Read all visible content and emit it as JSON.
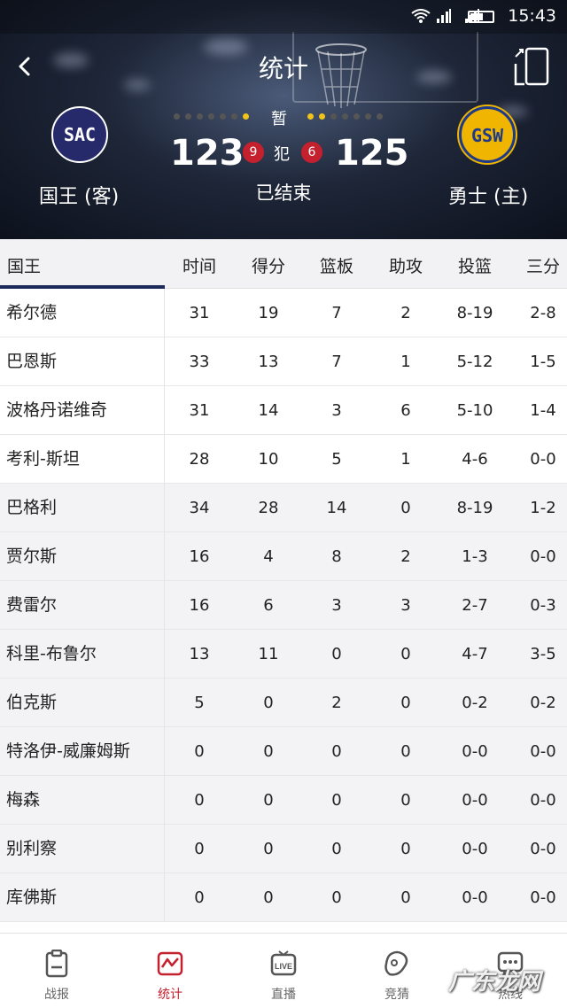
{
  "status_bar": {
    "time": "15:43"
  },
  "header": {
    "title": "统计",
    "away": {
      "abbr": "SAC",
      "name": "国王 (客)",
      "score": "123",
      "fouls": "9",
      "logo_color": "#272a6a"
    },
    "home": {
      "abbr": "GSW",
      "name": "勇士 (主)",
      "score": "125",
      "fouls": "6",
      "logo_color": "#f0b500"
    },
    "timeout_label": "暂",
    "foul_label": "犯",
    "game_status": "已结束",
    "timeouts": {
      "away": [
        "#555",
        "#555",
        "#555",
        "#555",
        "#555",
        "#555",
        "#f0c419"
      ],
      "home": [
        "#f0c419",
        "#f0c419",
        "#555",
        "#555",
        "#555",
        "#555",
        "#555"
      ]
    }
  },
  "table": {
    "team_tab": "国王",
    "columns": [
      "时间",
      "得分",
      "篮板",
      "助攻",
      "投篮",
      "三分"
    ],
    "rows": [
      {
        "name": "希尔德",
        "min": "31",
        "pts": "19",
        "reb": "7",
        "ast": "2",
        "fg": "8-19",
        "tp": "2-8",
        "starter": true
      },
      {
        "name": "巴恩斯",
        "min": "33",
        "pts": "13",
        "reb": "7",
        "ast": "1",
        "fg": "5-12",
        "tp": "1-5",
        "starter": true
      },
      {
        "name": "波格丹诺维奇",
        "min": "31",
        "pts": "14",
        "reb": "3",
        "ast": "6",
        "fg": "5-10",
        "tp": "1-4",
        "starter": true
      },
      {
        "name": "考利-斯坦",
        "min": "28",
        "pts": "10",
        "reb": "5",
        "ast": "1",
        "fg": "4-6",
        "tp": "0-0",
        "starter": true
      },
      {
        "name": "巴格利",
        "min": "34",
        "pts": "28",
        "reb": "14",
        "ast": "0",
        "fg": "8-19",
        "tp": "1-2",
        "starter": false
      },
      {
        "name": "贾尔斯",
        "min": "16",
        "pts": "4",
        "reb": "8",
        "ast": "2",
        "fg": "1-3",
        "tp": "0-0",
        "starter": false
      },
      {
        "name": "费雷尔",
        "min": "16",
        "pts": "6",
        "reb": "3",
        "ast": "3",
        "fg": "2-7",
        "tp": "0-3",
        "starter": false
      },
      {
        "name": "科里-布鲁尔",
        "min": "13",
        "pts": "11",
        "reb": "0",
        "ast": "0",
        "fg": "4-7",
        "tp": "3-5",
        "starter": false
      },
      {
        "name": "伯克斯",
        "min": "5",
        "pts": "0",
        "reb": "2",
        "ast": "0",
        "fg": "0-2",
        "tp": "0-2",
        "starter": false
      },
      {
        "name": "特洛伊-威廉姆斯",
        "min": "0",
        "pts": "0",
        "reb": "0",
        "ast": "0",
        "fg": "0-0",
        "tp": "0-0",
        "starter": false
      },
      {
        "name": "梅森",
        "min": "0",
        "pts": "0",
        "reb": "0",
        "ast": "0",
        "fg": "0-0",
        "tp": "0-0",
        "starter": false
      },
      {
        "name": "别利察",
        "min": "0",
        "pts": "0",
        "reb": "0",
        "ast": "0",
        "fg": "0-0",
        "tp": "0-0",
        "starter": false
      },
      {
        "name": "库佛斯",
        "min": "0",
        "pts": "0",
        "reb": "0",
        "ast": "0",
        "fg": "0-0",
        "tp": "0-0",
        "starter": false
      }
    ]
  },
  "bottom_nav": [
    {
      "label": "战报",
      "icon": "report-icon",
      "active": false
    },
    {
      "label": "统计",
      "icon": "stats-icon",
      "active": true
    },
    {
      "label": "直播",
      "icon": "live-icon",
      "active": false
    },
    {
      "label": "竞猜",
      "icon": "guess-icon",
      "active": false
    },
    {
      "label": "热线",
      "icon": "chat-icon",
      "active": false
    }
  ],
  "watermark": "广东龙网",
  "colors": {
    "accent": "#c5202e",
    "tab_underline": "#1d2a5a"
  }
}
